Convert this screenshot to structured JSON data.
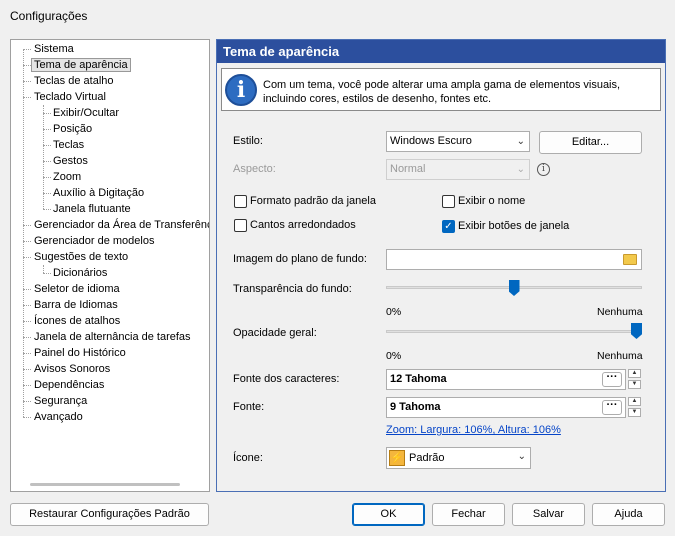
{
  "window": {
    "title": "Configurações"
  },
  "tree": {
    "items": [
      {
        "label": "Sistema",
        "level": 0
      },
      {
        "label": "Tema de aparência",
        "level": 0,
        "selected": true
      },
      {
        "label": "Teclas de atalho",
        "level": 0
      },
      {
        "label": "Teclado Virtual",
        "level": 0
      },
      {
        "label": "Exibir/Ocultar",
        "level": 1
      },
      {
        "label": "Posição",
        "level": 1
      },
      {
        "label": "Teclas",
        "level": 1
      },
      {
        "label": "Gestos",
        "level": 1
      },
      {
        "label": "Zoom",
        "level": 1
      },
      {
        "label": "Auxílio à Digitação",
        "level": 1
      },
      {
        "label": "Janela flutuante",
        "level": 1
      },
      {
        "label": "Gerenciador da Área de Transferência",
        "level": 0
      },
      {
        "label": "Gerenciador de modelos",
        "level": 0
      },
      {
        "label": "Sugestões de texto",
        "level": 0
      },
      {
        "label": "Dicionários",
        "level": 1
      },
      {
        "label": "Seletor de idioma",
        "level": 0
      },
      {
        "label": "Barra de Idiomas",
        "level": 0
      },
      {
        "label": "Ícones de atalhos",
        "level": 0
      },
      {
        "label": "Janela de alternância de tarefas",
        "level": 0
      },
      {
        "label": "Painel do Histórico",
        "level": 0
      },
      {
        "label": "Avisos Sonoros",
        "level": 0
      },
      {
        "label": "Dependências",
        "level": 0
      },
      {
        "label": "Segurança",
        "level": 0
      },
      {
        "label": "Avançado",
        "level": 0
      }
    ]
  },
  "panel": {
    "title": "Tema de aparência",
    "info_text": "Com um tema, você pode alterar uma ampla gama de elementos visuais, incluindo cores, estilos de desenho, fontes etc.",
    "style_label": "Estilo:",
    "style_value": "Windows Escuro",
    "edit_button": "Editar...",
    "aspect_label": "Aspecto:",
    "aspect_value": "Normal",
    "chk_window_format": {
      "label": "Formato padrão da janela",
      "checked": false
    },
    "chk_show_name": {
      "label": "Exibir o nome",
      "checked": false
    },
    "chk_rounded": {
      "label": "Cantos arredondados",
      "checked": false
    },
    "chk_window_buttons": {
      "label": "Exibir botões de janela",
      "checked": true
    },
    "bg_image_label": "Imagem do plano de fundo:",
    "bg_image_value": "",
    "bg_transparency_label": "Transparência do fundo:",
    "bg_transparency_fraction": 0.5,
    "bg_transparency_min": "0%",
    "bg_transparency_max": "Nenhuma",
    "opacity_label": "Opacidade geral:",
    "opacity_fraction": 1.0,
    "opacity_min": "0%",
    "opacity_max": "Nenhuma",
    "char_font_label": "Fonte dos caracteres:",
    "char_font_value": "12 Tahoma",
    "font_label": "Fonte:",
    "font_value": "9 Tahoma",
    "zoom_link": "Zoom: Largura: 106%, Altura: 106%",
    "icon_label": "Ícone:",
    "icon_value": "Padrão"
  },
  "footer": {
    "restore_button": "Restaurar Configurações Padrão",
    "ok_button": "OK",
    "close_button": "Fechar",
    "save_button": "Salvar",
    "help_button": "Ajuda"
  },
  "colors": {
    "accent": "#0067c0",
    "header": "#2c4f9e"
  }
}
